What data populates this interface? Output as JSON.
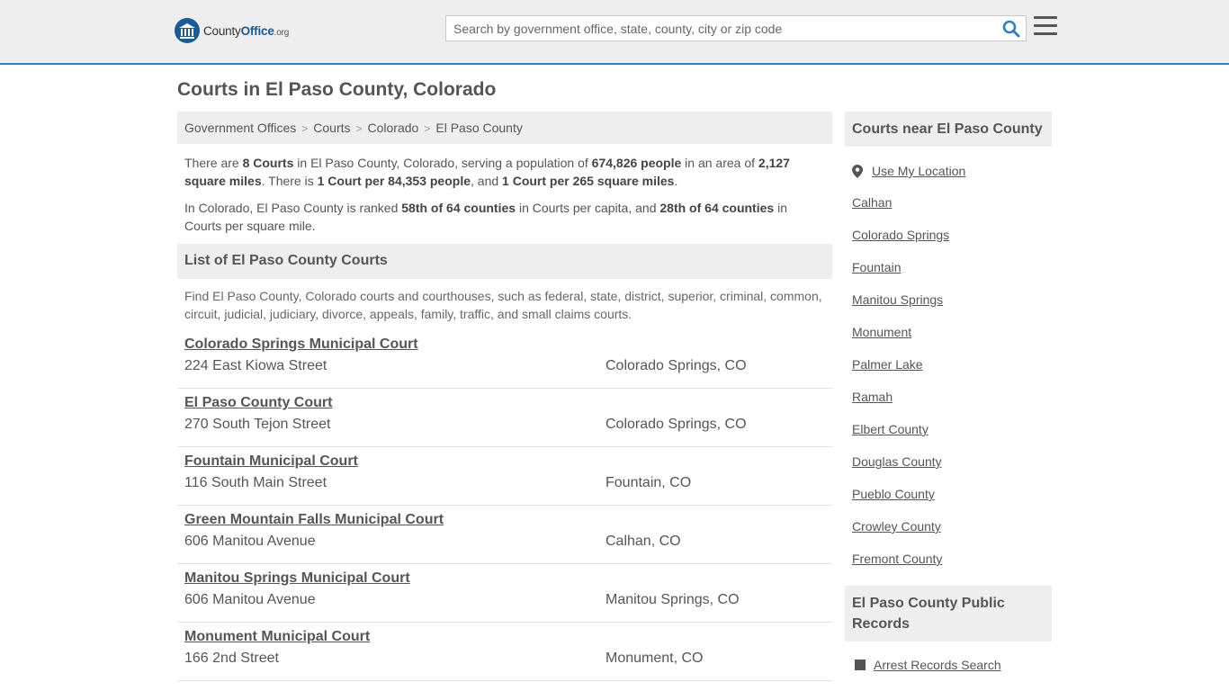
{
  "header": {
    "logo_prefix": "County",
    "logo_brand": "Office",
    "logo_tld": ".org",
    "search_placeholder": "Search by government office, state, county, city or zip code",
    "search_icon": "search-icon",
    "menu_icon": "hamburger-menu-icon",
    "accent_color": "#2e7fc4"
  },
  "page": {
    "title": "Courts in El Paso County, Colorado"
  },
  "breadcrumb": [
    "Government Offices",
    "Courts",
    "Colorado",
    "El Paso County"
  ],
  "intro": {
    "p1": [
      {
        "t": "There are ",
        "b": false
      },
      {
        "t": "8 Courts",
        "b": true
      },
      {
        "t": " in El Paso County, Colorado, serving a population of ",
        "b": false
      },
      {
        "t": "674,826 people",
        "b": true
      },
      {
        "t": " in an area of ",
        "b": false
      },
      {
        "t": "2,127 square miles",
        "b": true
      },
      {
        "t": ". There is ",
        "b": false
      },
      {
        "t": "1 Court per 84,353 people",
        "b": true
      },
      {
        "t": ", and ",
        "b": false
      },
      {
        "t": "1 Court per 265 square miles",
        "b": true
      },
      {
        "t": ".",
        "b": false
      }
    ],
    "p2": [
      {
        "t": "In Colorado, El Paso County is ranked ",
        "b": false
      },
      {
        "t": "58th of 64 counties",
        "b": true
      },
      {
        "t": " in Courts per capita, and ",
        "b": false
      },
      {
        "t": "28th of 64 counties",
        "b": true
      },
      {
        "t": " in Courts per square mile.",
        "b": false
      }
    ]
  },
  "list": {
    "heading": "List of El Paso County Courts",
    "description": "Find El Paso County, Colorado courts and courthouses, such as federal, state, district, superior, criminal, common, circuit, judicial, judiciary, divorce, appeals, family, traffic, and small claims courts.",
    "courts": [
      {
        "name": "Colorado Springs Municipal Court",
        "address": "224 East Kiowa Street",
        "city": "Colorado Springs, CO"
      },
      {
        "name": "El Paso County Court",
        "address": "270 South Tejon Street",
        "city": "Colorado Springs, CO"
      },
      {
        "name": "Fountain Municipal Court",
        "address": "116 South Main Street",
        "city": "Fountain, CO"
      },
      {
        "name": "Green Mountain Falls Municipal Court",
        "address": "606 Manitou Avenue",
        "city": "Calhan, CO"
      },
      {
        "name": "Manitou Springs Municipal Court",
        "address": "606 Manitou Avenue",
        "city": "Manitou Springs, CO"
      },
      {
        "name": "Monument Municipal Court",
        "address": "166 2nd Street",
        "city": "Monument, CO"
      }
    ]
  },
  "sidebar": {
    "nearby_heading": "Courts near El Paso County",
    "use_location": "Use My Location",
    "location_icon": "map-pin-icon",
    "nearby": [
      "Calhan",
      "Colorado Springs",
      "Fountain",
      "Manitou Springs",
      "Monument",
      "Palmer Lake",
      "Ramah",
      "Elbert County",
      "Douglas County",
      "Pueblo County",
      "Crowley County",
      "Fremont County"
    ],
    "records_heading": "El Paso County Public Records",
    "records": [
      "Arrest Records Search"
    ]
  }
}
